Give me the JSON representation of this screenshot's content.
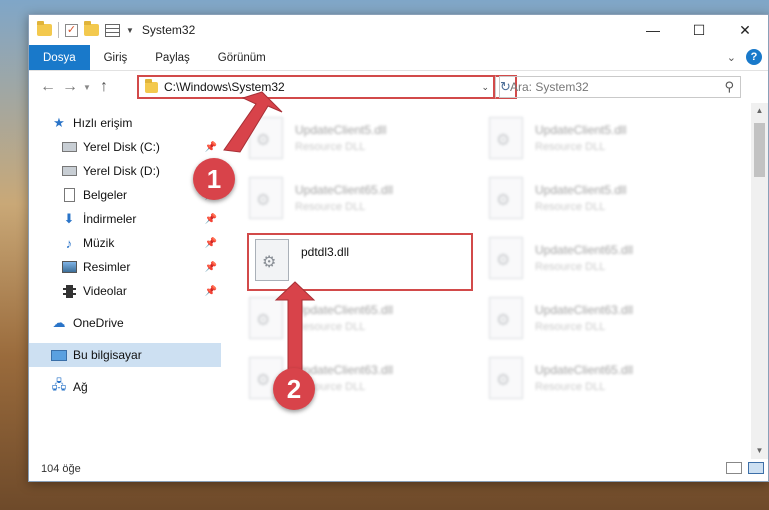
{
  "window": {
    "title": "System32",
    "controls": {
      "minimize": "—",
      "maximize": "☐",
      "close": "✕"
    }
  },
  "ribbon": {
    "tabs": [
      "Dosya",
      "Giriş",
      "Paylaş",
      "Görünüm"
    ],
    "active_tab": "Dosya"
  },
  "navigation": {
    "address_path": "C:\\Windows\\System32",
    "search_placeholder": "Ara: System32"
  },
  "sidebar": {
    "items": [
      {
        "label": "Hızlı erişim",
        "icon": "star-icon",
        "pinned": false,
        "indent": false
      },
      {
        "label": "Yerel Disk (C:)",
        "icon": "drive-icon",
        "pinned": true,
        "indent": true
      },
      {
        "label": "Yerel Disk (D:)",
        "icon": "drive-icon",
        "pinned": true,
        "indent": true
      },
      {
        "label": "Belgeler",
        "icon": "document-icon",
        "pinned": true,
        "indent": true
      },
      {
        "label": "İndirmeler",
        "icon": "download-icon",
        "pinned": true,
        "indent": true
      },
      {
        "label": "Müzik",
        "icon": "music-icon",
        "pinned": true,
        "indent": true
      },
      {
        "label": "Resimler",
        "icon": "pictures-icon",
        "pinned": true,
        "indent": true
      },
      {
        "label": "Videolar",
        "icon": "video-icon",
        "pinned": true,
        "indent": true
      },
      {
        "label": "OneDrive",
        "icon": "cloud-icon",
        "pinned": false,
        "indent": false
      },
      {
        "label": "Bu bilgisayar",
        "icon": "computer-icon",
        "pinned": false,
        "indent": false,
        "selected": true
      },
      {
        "label": "Ağ",
        "icon": "network-icon",
        "pinned": false,
        "indent": false
      }
    ]
  },
  "files": [
    {
      "name": "UpdateClient5.dll",
      "type": "Resource DLL",
      "blurred": true
    },
    {
      "name": "UpdateClient5.dll",
      "type": "Resource DLL",
      "blurred": true
    },
    {
      "name": "UpdateClient65.dll",
      "type": "Resource DLL",
      "blurred": true
    },
    {
      "name": "UpdateClient5.dll",
      "type": "Resource DLL",
      "blurred": true
    },
    {
      "name": "pdtdl3.dll",
      "type": "",
      "blurred": false,
      "highlighted": true
    },
    {
      "name": "UpdateClient65.dll",
      "type": "Resource DLL",
      "blurred": true
    },
    {
      "name": "UpdateClient65.dll",
      "type": "Resource DLL",
      "blurred": true
    },
    {
      "name": "UpdateClient63.dll",
      "type": "Resource DLL",
      "blurred": true
    },
    {
      "name": "UpdateClient63.dll",
      "type": "Resource DLL",
      "blurred": true
    },
    {
      "name": "UpdateClient65.dll",
      "type": "Resource DLL",
      "blurred": true
    }
  ],
  "status": {
    "item_count": "104 öğe"
  },
  "annotations": {
    "step1": "1",
    "step2": "2",
    "color": "#d8434a"
  }
}
